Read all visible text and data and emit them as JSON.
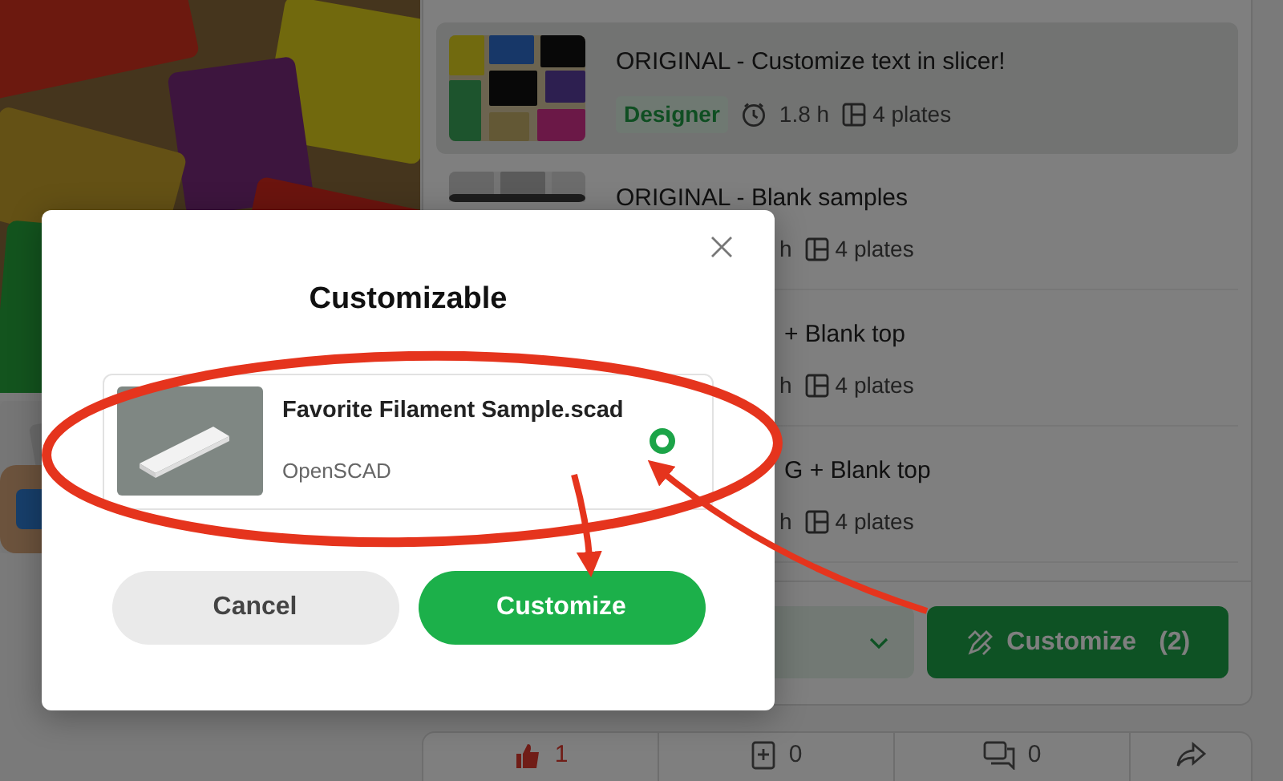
{
  "profiles": [
    {
      "title": "ORIGINAL - Customize text in slicer!",
      "selected": true,
      "kind": "visible",
      "tag": "Designer",
      "time": "1.8 h",
      "plates": "4 plates"
    },
    {
      "title": "ORIGINAL - Blank samples",
      "selected": false,
      "kind": "meta-covered",
      "time": "h",
      "plates": "4 plates"
    },
    {
      "title": "+ Blank top",
      "selected": false,
      "kind": "covered",
      "time": "h",
      "plates": "4 plates"
    },
    {
      "title": "G + Blank top",
      "selected": false,
      "kind": "covered",
      "time": "h",
      "plates": "4 plates"
    }
  ],
  "customize_button": {
    "label": "Customize",
    "count": "(2)"
  },
  "stats": [
    {
      "kind": "like",
      "count": "1",
      "active": true
    },
    {
      "kind": "add",
      "count": "0",
      "active": false
    },
    {
      "kind": "comment",
      "count": "0",
      "active": false
    },
    {
      "kind": "share",
      "active": false
    }
  ],
  "modal": {
    "title": "Customizable",
    "files": [
      {
        "name": "Favorite Filament Sample.scad",
        "type": "OpenSCAD",
        "selected": true
      }
    ],
    "buttons": [
      {
        "label": "Cancel",
        "kind": "secondary"
      },
      {
        "label": "Customize",
        "kind": "primary"
      }
    ]
  }
}
